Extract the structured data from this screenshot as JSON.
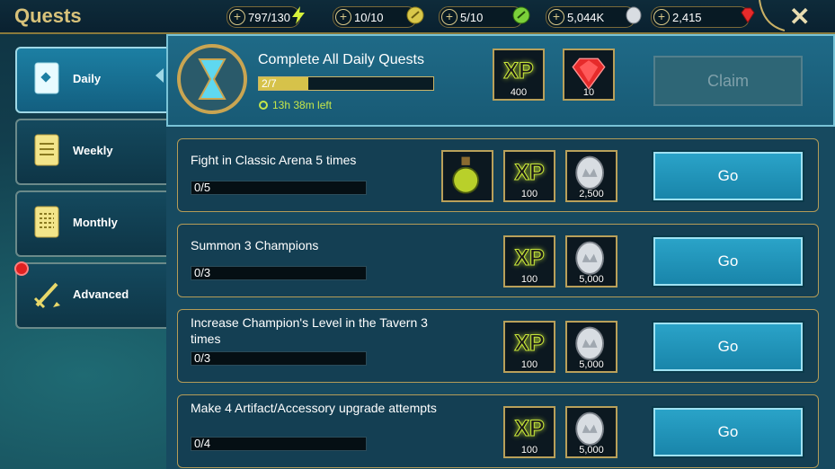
{
  "header": {
    "title": "Quests",
    "resources": [
      {
        "value": "797/130",
        "icon": "energy-icon"
      },
      {
        "value": "10/10",
        "icon": "silver-key-icon"
      },
      {
        "value": "5/10",
        "icon": "green-key-icon"
      },
      {
        "value": "5,044K",
        "icon": "silver-coin-icon"
      },
      {
        "value": "2,415",
        "icon": "gem-icon"
      }
    ],
    "close_icon": "close-icon"
  },
  "sidebar": {
    "tabs": [
      {
        "label": "Daily",
        "active": true,
        "icon": "daily-scroll-icon"
      },
      {
        "label": "Weekly",
        "active": false,
        "icon": "weekly-scroll-icon"
      },
      {
        "label": "Monthly",
        "active": false,
        "icon": "monthly-scroll-icon"
      },
      {
        "label": "Advanced",
        "active": false,
        "icon": "advanced-sword-icon",
        "notification": true
      }
    ]
  },
  "daily_goal": {
    "title": "Complete All Daily Quests",
    "progress_text": "2/7",
    "progress": 0.286,
    "timer": "13h 38m left",
    "rewards": [
      {
        "type": "xp",
        "label": "XP",
        "value": "400"
      },
      {
        "type": "gem",
        "value": "10"
      }
    ],
    "claim_label": "Claim"
  },
  "quests": [
    {
      "title": "Fight in Classic Arena 5 times",
      "progress_text": "0/5",
      "rewards": [
        {
          "type": "potion",
          "value": ""
        },
        {
          "type": "xp",
          "label": "XP",
          "value": "100"
        },
        {
          "type": "silver",
          "value": "2,500"
        }
      ],
      "button": "Go"
    },
    {
      "title": "Summon 3 Champions",
      "progress_text": "0/3",
      "rewards": [
        {
          "type": "xp",
          "label": "XP",
          "value": "100"
        },
        {
          "type": "silver",
          "value": "5,000"
        }
      ],
      "button": "Go"
    },
    {
      "title": "Increase Champion's Level in the Tavern 3 times",
      "progress_text": "0/3",
      "rewards": [
        {
          "type": "xp",
          "label": "XP",
          "value": "100"
        },
        {
          "type": "silver",
          "value": "5,000"
        }
      ],
      "button": "Go"
    },
    {
      "title": "Make 4 Artifact/Accessory upgrade attempts",
      "progress_text": "0/4",
      "rewards": [
        {
          "type": "xp",
          "label": "XP",
          "value": "100"
        },
        {
          "type": "silver",
          "value": "5,000"
        }
      ],
      "button": "Go"
    }
  ]
}
